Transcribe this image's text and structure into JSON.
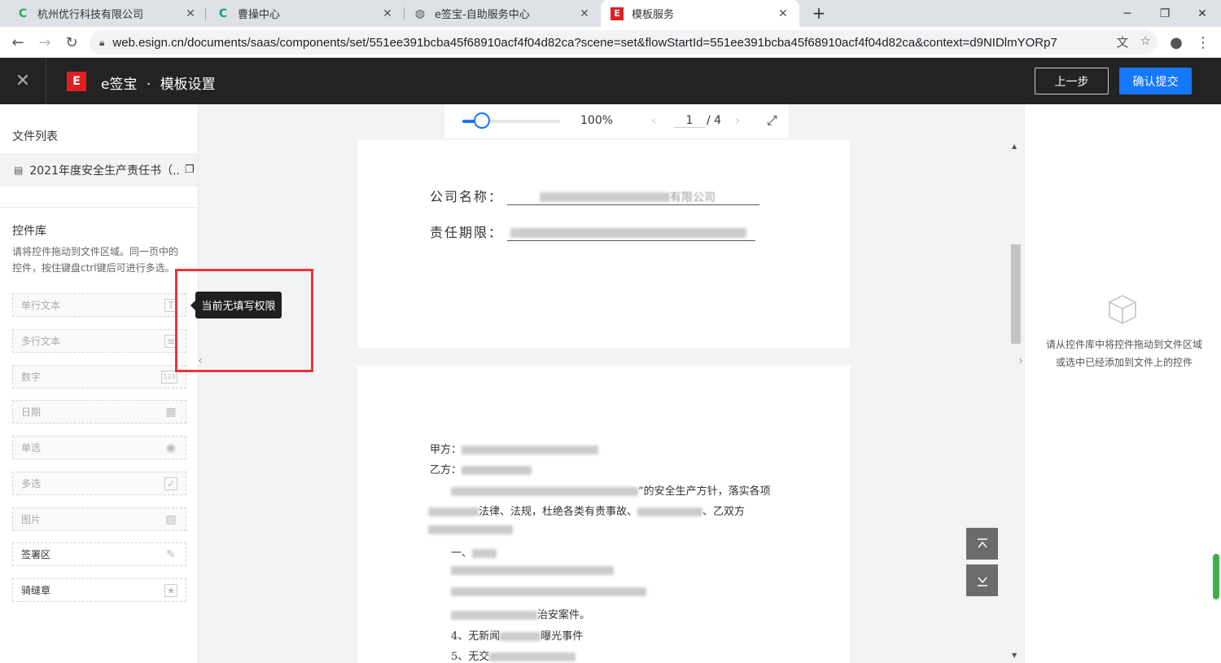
{
  "browser": {
    "tabs": [
      {
        "title": "杭州优行科技有限公司",
        "icon": "C",
        "icon_color": "#27ae60"
      },
      {
        "title": "曹操中心",
        "icon": "C",
        "icon_color": "#16a085"
      },
      {
        "title": "e签宝-自助服务中心",
        "icon": "globe-icon",
        "icon_color": "#555555"
      },
      {
        "title": "模板服务",
        "icon": "E",
        "icon_color": "#e02020"
      }
    ],
    "url": "web.esign.cn/documents/saas/components/set/551ee391bcba45f68910acf4f04d82ca?scene=set&flowStartId=551ee391bcba45f68910acf4f04d82ca&context=d9NIDlmYORp7"
  },
  "header": {
    "brand": "e签宝",
    "separator": "·",
    "page_title": "模板设置",
    "prev_label": "上一步",
    "submit_label": "确认提交",
    "accent": "#1677ff"
  },
  "sidebar": {
    "file_list_title": "文件列表",
    "file_name": "2021年度安全生产责任书（..",
    "library_title": "控件库",
    "library_desc": "请将控件拖动到文件区域。同一页中的控件，按住键盘ctrl键后可进行多选。",
    "controls": [
      {
        "label": "单行文本",
        "icon": "T",
        "enabled": false
      },
      {
        "label": "多行文本",
        "icon": "≡",
        "enabled": false
      },
      {
        "label": "数字",
        "icon": "123",
        "enabled": false
      },
      {
        "label": "日期",
        "icon": "▦",
        "enabled": false
      },
      {
        "label": "单选",
        "icon": "◉",
        "enabled": false
      },
      {
        "label": "多选",
        "icon": "✓",
        "enabled": false
      },
      {
        "label": "图片",
        "icon": "▨",
        "enabled": false
      },
      {
        "label": "签署区",
        "icon": "✎",
        "enabled": true
      },
      {
        "label": "骑缝章",
        "icon": "★",
        "enabled": true
      }
    ]
  },
  "tooltip": {
    "text": "当前无填写权限"
  },
  "viewer": {
    "zoom_label": "100%",
    "zoom_fraction": 0.2,
    "current_page": "1",
    "total_pages": "/ 4",
    "page1": {
      "line1_label": "公司名称：",
      "line1_visible": "有限公司",
      "line2_label": "责任期限："
    },
    "page2": {
      "party_a": "甲方：",
      "party_b": "乙方：",
      "para1_visible": "”的安全生产方针，落实各项",
      "para2_visible": "法律、法规，杜绝各类有责事故、",
      "para2_tail": "、乙双方",
      "item1_prefix": "一、",
      "item_3_tail": "治安案件。",
      "item_4_prefix": "4、无新闻",
      "item_4_tail": "曝光事件",
      "item_5_prefix": "5、无交"
    }
  },
  "right_panel": {
    "hint_line1": "请从控件库中将控件拖动到文件区域",
    "hint_line2": "或选中已经添加到文件上的控件"
  }
}
